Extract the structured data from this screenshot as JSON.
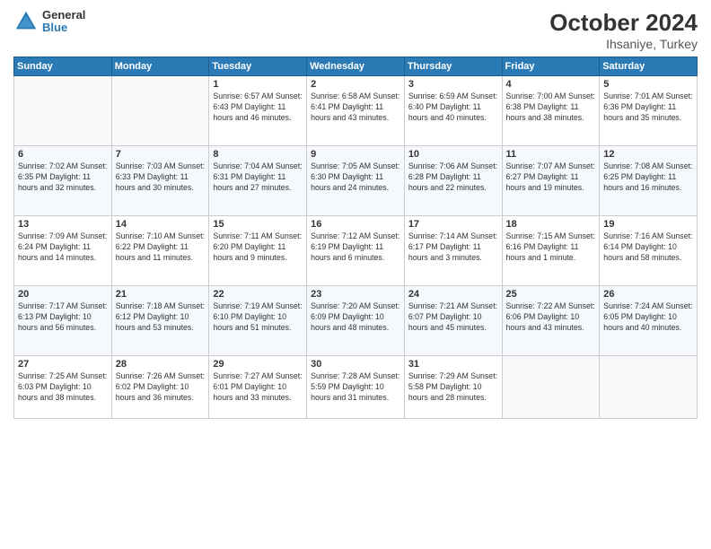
{
  "header": {
    "logo": {
      "general": "General",
      "blue": "Blue"
    },
    "title": "October 2024",
    "location": "Ihsaniye, Turkey"
  },
  "weekdays": [
    "Sunday",
    "Monday",
    "Tuesday",
    "Wednesday",
    "Thursday",
    "Friday",
    "Saturday"
  ],
  "weeks": [
    [
      {
        "day": "",
        "info": ""
      },
      {
        "day": "",
        "info": ""
      },
      {
        "day": "1",
        "info": "Sunrise: 6:57 AM\nSunset: 6:43 PM\nDaylight: 11 hours and 46 minutes."
      },
      {
        "day": "2",
        "info": "Sunrise: 6:58 AM\nSunset: 6:41 PM\nDaylight: 11 hours and 43 minutes."
      },
      {
        "day": "3",
        "info": "Sunrise: 6:59 AM\nSunset: 6:40 PM\nDaylight: 11 hours and 40 minutes."
      },
      {
        "day": "4",
        "info": "Sunrise: 7:00 AM\nSunset: 6:38 PM\nDaylight: 11 hours and 38 minutes."
      },
      {
        "day": "5",
        "info": "Sunrise: 7:01 AM\nSunset: 6:36 PM\nDaylight: 11 hours and 35 minutes."
      }
    ],
    [
      {
        "day": "6",
        "info": "Sunrise: 7:02 AM\nSunset: 6:35 PM\nDaylight: 11 hours and 32 minutes."
      },
      {
        "day": "7",
        "info": "Sunrise: 7:03 AM\nSunset: 6:33 PM\nDaylight: 11 hours and 30 minutes."
      },
      {
        "day": "8",
        "info": "Sunrise: 7:04 AM\nSunset: 6:31 PM\nDaylight: 11 hours and 27 minutes."
      },
      {
        "day": "9",
        "info": "Sunrise: 7:05 AM\nSunset: 6:30 PM\nDaylight: 11 hours and 24 minutes."
      },
      {
        "day": "10",
        "info": "Sunrise: 7:06 AM\nSunset: 6:28 PM\nDaylight: 11 hours and 22 minutes."
      },
      {
        "day": "11",
        "info": "Sunrise: 7:07 AM\nSunset: 6:27 PM\nDaylight: 11 hours and 19 minutes."
      },
      {
        "day": "12",
        "info": "Sunrise: 7:08 AM\nSunset: 6:25 PM\nDaylight: 11 hours and 16 minutes."
      }
    ],
    [
      {
        "day": "13",
        "info": "Sunrise: 7:09 AM\nSunset: 6:24 PM\nDaylight: 11 hours and 14 minutes."
      },
      {
        "day": "14",
        "info": "Sunrise: 7:10 AM\nSunset: 6:22 PM\nDaylight: 11 hours and 11 minutes."
      },
      {
        "day": "15",
        "info": "Sunrise: 7:11 AM\nSunset: 6:20 PM\nDaylight: 11 hours and 9 minutes."
      },
      {
        "day": "16",
        "info": "Sunrise: 7:12 AM\nSunset: 6:19 PM\nDaylight: 11 hours and 6 minutes."
      },
      {
        "day": "17",
        "info": "Sunrise: 7:14 AM\nSunset: 6:17 PM\nDaylight: 11 hours and 3 minutes."
      },
      {
        "day": "18",
        "info": "Sunrise: 7:15 AM\nSunset: 6:16 PM\nDaylight: 11 hours and 1 minute."
      },
      {
        "day": "19",
        "info": "Sunrise: 7:16 AM\nSunset: 6:14 PM\nDaylight: 10 hours and 58 minutes."
      }
    ],
    [
      {
        "day": "20",
        "info": "Sunrise: 7:17 AM\nSunset: 6:13 PM\nDaylight: 10 hours and 56 minutes."
      },
      {
        "day": "21",
        "info": "Sunrise: 7:18 AM\nSunset: 6:12 PM\nDaylight: 10 hours and 53 minutes."
      },
      {
        "day": "22",
        "info": "Sunrise: 7:19 AM\nSunset: 6:10 PM\nDaylight: 10 hours and 51 minutes."
      },
      {
        "day": "23",
        "info": "Sunrise: 7:20 AM\nSunset: 6:09 PM\nDaylight: 10 hours and 48 minutes."
      },
      {
        "day": "24",
        "info": "Sunrise: 7:21 AM\nSunset: 6:07 PM\nDaylight: 10 hours and 45 minutes."
      },
      {
        "day": "25",
        "info": "Sunrise: 7:22 AM\nSunset: 6:06 PM\nDaylight: 10 hours and 43 minutes."
      },
      {
        "day": "26",
        "info": "Sunrise: 7:24 AM\nSunset: 6:05 PM\nDaylight: 10 hours and 40 minutes."
      }
    ],
    [
      {
        "day": "27",
        "info": "Sunrise: 7:25 AM\nSunset: 6:03 PM\nDaylight: 10 hours and 38 minutes."
      },
      {
        "day": "28",
        "info": "Sunrise: 7:26 AM\nSunset: 6:02 PM\nDaylight: 10 hours and 36 minutes."
      },
      {
        "day": "29",
        "info": "Sunrise: 7:27 AM\nSunset: 6:01 PM\nDaylight: 10 hours and 33 minutes."
      },
      {
        "day": "30",
        "info": "Sunrise: 7:28 AM\nSunset: 5:59 PM\nDaylight: 10 hours and 31 minutes."
      },
      {
        "day": "31",
        "info": "Sunrise: 7:29 AM\nSunset: 5:58 PM\nDaylight: 10 hours and 28 minutes."
      },
      {
        "day": "",
        "info": ""
      },
      {
        "day": "",
        "info": ""
      }
    ]
  ]
}
